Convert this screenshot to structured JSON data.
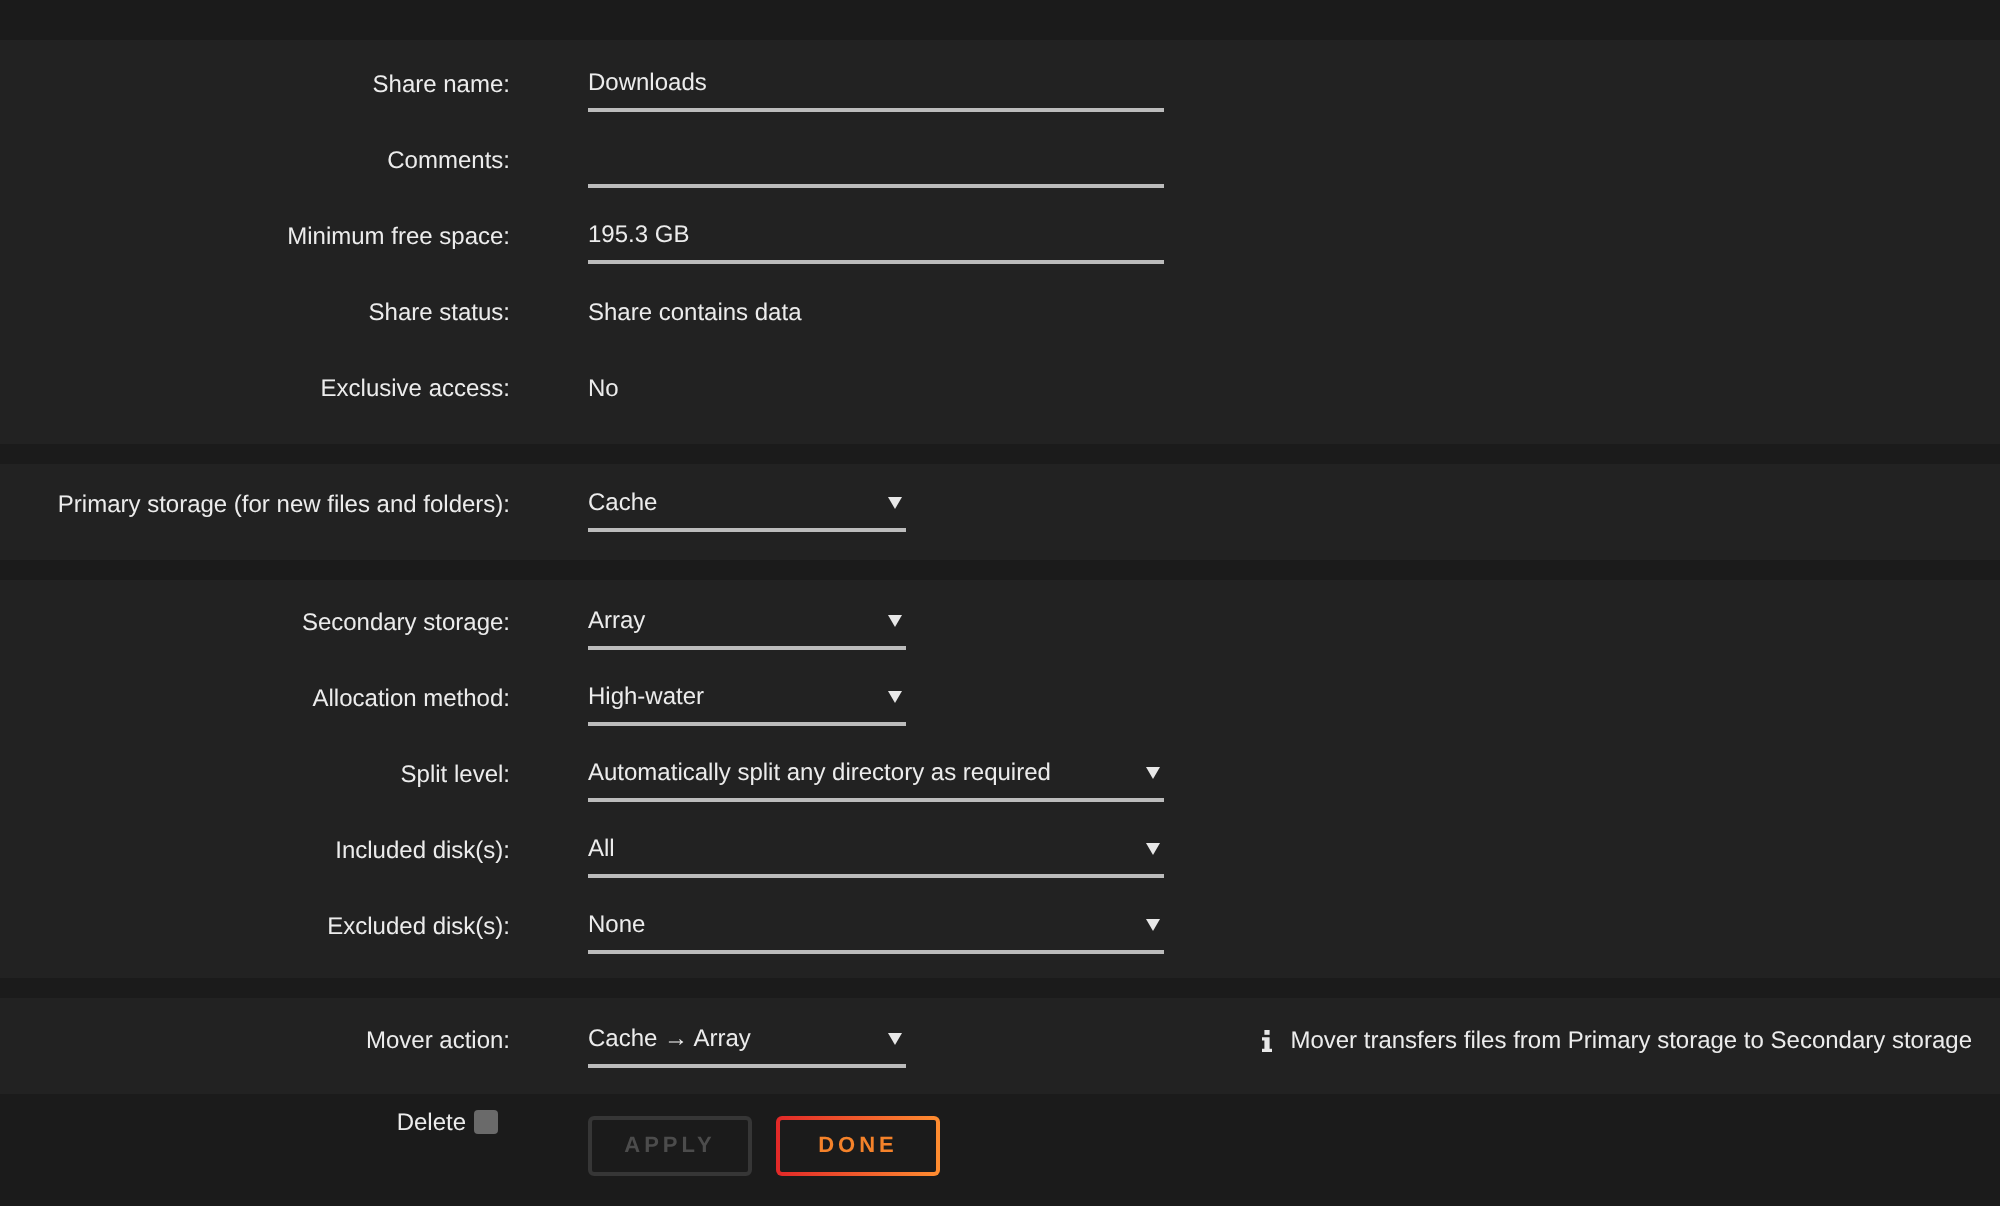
{
  "sections": [
    {
      "fields": [
        {
          "kind": "text",
          "label": "Share name:",
          "value": "Downloads"
        },
        {
          "kind": "text",
          "label": "Comments:"
        },
        {
          "kind": "text",
          "label": "Minimum free space:",
          "value": "195.3 GB"
        },
        {
          "kind": "static",
          "label": "Share status:",
          "value": "Share contains data"
        },
        {
          "kind": "static",
          "label": "Exclusive access:",
          "value": "No"
        }
      ]
    },
    {
      "fields": [
        {
          "kind": "select",
          "wide": false,
          "label": "Primary storage (for new files and folders):",
          "value": "Cache"
        }
      ]
    },
    {
      "fields": [
        {
          "kind": "select",
          "wide": false,
          "label": "Secondary storage:",
          "value": "Array"
        },
        {
          "kind": "select",
          "wide": false,
          "label": "Allocation method:",
          "value": "High-water"
        },
        {
          "kind": "select",
          "wide": true,
          "label": "Split level:",
          "value": "Automatically split any directory as required"
        },
        {
          "kind": "select",
          "wide": true,
          "label": "Included disk(s):",
          "value": "All"
        },
        {
          "kind": "select",
          "wide": true,
          "label": "Excluded disk(s):",
          "value": "None"
        }
      ]
    },
    {
      "fields": [
        {
          "kind": "select",
          "wide": false,
          "label": "Mover action:",
          "value": "Cache → Array",
          "note": "Mover transfers files from Primary storage to Secondary storage"
        }
      ]
    }
  ],
  "delete": {
    "label": "Delete",
    "checked": false
  },
  "buttons": [
    {
      "label": "APPLY",
      "disabled": true
    },
    {
      "label": "DONE",
      "disabled": false
    }
  ]
}
